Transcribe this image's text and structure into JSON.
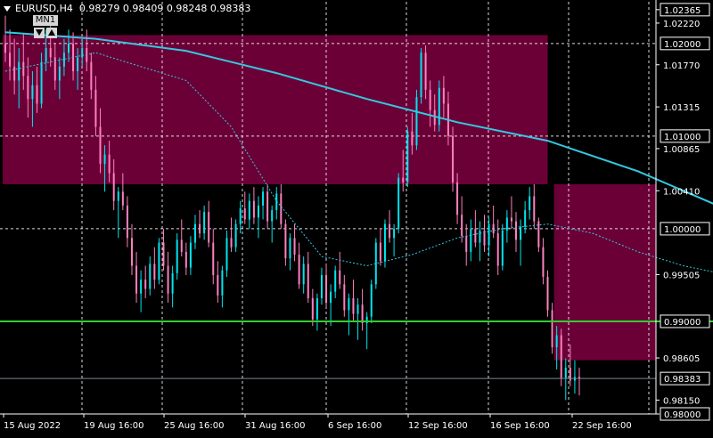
{
  "header": {
    "symbol": "EURUSD,H4",
    "open": "0.98279",
    "high": "0.98409",
    "low": "0.98248",
    "close": "0.98383",
    "timeframe_badge": "MN1"
  },
  "colors": {
    "background": "#000000",
    "grid": "#ffffff",
    "bull": "#00e5ee",
    "bear": "#ff7fbf",
    "zone": "#6b0037",
    "ma_solid": "#33c9e0",
    "ma_dashed": "#33c9e0",
    "level_line": "#32cd32",
    "price_line": "#778899",
    "axis_text": "#ffffff",
    "label_box": "#ffffff"
  },
  "chart_data": {
    "type": "candlestick",
    "title": "",
    "xlabel": "",
    "ylabel": "",
    "ylim": [
      0.98,
      1.0245
    ],
    "y_ticks": [
      "1.02365",
      "1.02220",
      "1.01770",
      "1.01315",
      "1.00865",
      "1.00410",
      "0.99505",
      "0.98605",
      "0.98150",
      "0.98000"
    ],
    "y_boxed_labels": [
      "1.02365",
      "1.02000",
      "1.01000",
      "1.00000",
      "0.99000",
      "0.98383",
      "0.98000"
    ],
    "x_ticks": [
      "15 Aug 2022",
      "19 Aug 16:00",
      "25 Aug 16:00",
      "31 Aug 16:00",
      "6 Sep 16:00",
      "12 Sep 16:00",
      "16 Sep 16:00",
      "22 Sep 16:00"
    ],
    "current_price": 0.98383,
    "grid": true,
    "zones": [
      {
        "start_bar": 0,
        "end_bar": 120,
        "high": 1.0209,
        "low": 1.0048
      },
      {
        "start_bar": 122,
        "end_bar": 320,
        "high": 1.0048,
        "low": 0.9858
      }
    ],
    "levels": [
      {
        "value": 1.02,
        "start_bar": 190,
        "end_bar": 280
      },
      {
        "value": 0.9945,
        "start_bar": 190,
        "end_bar": 280
      },
      {
        "value": 0.99,
        "start_bar": 0,
        "end_bar": 280
      }
    ],
    "moving_averages": [
      {
        "style": "solid",
        "points": [
          [
            0,
            1.0212
          ],
          [
            20,
            1.0205
          ],
          [
            40,
            1.0192
          ],
          [
            60,
            1.0168
          ],
          [
            80,
            1.014
          ],
          [
            100,
            1.0115
          ],
          [
            120,
            1.0095
          ],
          [
            140,
            1.0062
          ],
          [
            160,
            1.002
          ],
          [
            180,
            1.0003
          ],
          [
            200,
            0.9996
          ],
          [
            220,
            0.9994
          ],
          [
            240,
            0.9996
          ],
          [
            260,
            0.9998
          ],
          [
            270,
            0.9993
          ],
          [
            280,
            0.9987
          ]
        ]
      },
      {
        "style": "dashed",
        "points": [
          [
            0,
            1.017
          ],
          [
            20,
            1.019
          ],
          [
            40,
            1.016
          ],
          [
            50,
            1.011
          ],
          [
            60,
            1.003
          ],
          [
            70,
            0.997
          ],
          [
            80,
            0.996
          ],
          [
            90,
            0.9972
          ],
          [
            100,
            0.999
          ],
          [
            110,
            1.0
          ],
          [
            120,
            1.0005
          ],
          [
            130,
            0.9995
          ],
          [
            140,
            0.9975
          ],
          [
            150,
            0.996
          ],
          [
            165,
            0.9945
          ],
          [
            175,
            0.995
          ],
          [
            185,
            0.998
          ],
          [
            195,
            1.005
          ],
          [
            205,
            1.0078
          ],
          [
            215,
            1.0075
          ],
          [
            225,
            1.005
          ],
          [
            235,
            1.001
          ],
          [
            245,
            0.9995
          ],
          [
            255,
            0.9998
          ],
          [
            265,
            0.9975
          ],
          [
            275,
            0.994
          ],
          [
            280,
            0.9927
          ]
        ]
      }
    ],
    "candles": [
      [
        1.02,
        1.023,
        1.018,
        1.019
      ],
      [
        1.019,
        1.0215,
        1.016,
        1.0175
      ],
      [
        1.0175,
        1.0205,
        1.0145,
        1.016
      ],
      [
        1.016,
        1.0195,
        1.013,
        1.018
      ],
      [
        1.018,
        1.021,
        1.015,
        1.0165
      ],
      [
        1.0165,
        1.0185,
        1.012,
        1.014
      ],
      [
        1.014,
        1.017,
        1.011,
        1.0155
      ],
      [
        1.0155,
        1.0175,
        1.0125,
        1.0135
      ],
      [
        1.0135,
        1.019,
        1.013,
        1.018
      ],
      [
        1.018,
        1.0215,
        1.017,
        1.0195
      ],
      [
        1.0195,
        1.022,
        1.0175,
        1.0185
      ],
      [
        1.0185,
        1.02,
        1.015,
        1.016
      ],
      [
        1.016,
        1.0185,
        1.014,
        1.0175
      ],
      [
        1.0175,
        1.0205,
        1.0165,
        1.019
      ],
      [
        1.019,
        1.0215,
        1.018,
        1.02
      ],
      [
        1.02,
        1.0212,
        1.016,
        1.017
      ],
      [
        1.017,
        1.0195,
        1.015,
        1.0185
      ],
      [
        1.0185,
        1.0205,
        1.0175,
        1.0195
      ],
      [
        1.0195,
        1.0215,
        1.017,
        1.018
      ],
      [
        1.018,
        1.019,
        1.014,
        1.015
      ],
      [
        1.015,
        1.0165,
        1.01,
        1.011
      ],
      [
        1.011,
        1.013,
        1.006,
        1.007
      ],
      [
        1.007,
        1.009,
        1.004,
        1.008
      ],
      [
        1.008,
        1.0095,
        1.005,
        1.006
      ],
      [
        1.006,
        1.0075,
        1.002,
        1.003
      ],
      [
        1.003,
        1.0045,
        0.999,
        1.004
      ],
      [
        1.004,
        1.006,
        1.002,
        1.0025
      ],
      [
        1.0025,
        1.0035,
        0.998,
        0.999
      ],
      [
        0.999,
        1.0005,
        0.995,
        0.996
      ],
      [
        0.996,
        0.9975,
        0.992,
        0.993
      ],
      [
        0.993,
        0.9955,
        0.991,
        0.9945
      ],
      [
        0.9945,
        0.996,
        0.9925,
        0.9935
      ],
      [
        0.9935,
        0.997,
        0.9928,
        0.9962
      ],
      [
        0.9962,
        0.998,
        0.9935,
        0.9945
      ],
      [
        0.9945,
        0.999,
        0.994,
        0.9985
      ],
      [
        0.9985,
        1.0,
        0.9955,
        0.996
      ],
      [
        0.996,
        0.9975,
        0.992,
        0.993
      ],
      [
        0.993,
        0.996,
        0.9915,
        0.9952
      ],
      [
        0.9952,
        0.9995,
        0.9945,
        0.9988
      ],
      [
        0.9988,
        1.001,
        0.997,
        0.9975
      ],
      [
        0.9975,
        0.9985,
        0.995,
        0.9958
      ],
      [
        0.9958,
        0.9992,
        0.995,
        0.9985
      ],
      [
        0.9985,
        1.0015,
        0.9978,
        1.0005
      ],
      [
        1.0005,
        1.002,
        0.999,
        0.9995
      ],
      [
        0.9995,
        1.0025,
        0.9988,
        1.0018
      ],
      [
        1.0018,
        1.003,
        0.998,
        0.9985
      ],
      [
        0.9985,
        1.0,
        0.994,
        0.995
      ],
      [
        0.995,
        0.9965,
        0.992,
        0.9928
      ],
      [
        0.9928,
        0.996,
        0.9915,
        0.9955
      ],
      [
        0.9955,
        0.9998,
        0.9948,
        0.999
      ],
      [
        0.999,
        1.0012,
        0.9975,
        0.998
      ],
      [
        0.998,
        1.001,
        0.9975,
        1.0005
      ],
      [
        1.0005,
        1.003,
        0.9995,
        1.0022
      ],
      [
        1.0022,
        1.004,
        1.0005,
        1.001
      ],
      [
        1.001,
        1.0038,
        1.0,
        1.003
      ],
      [
        1.003,
        1.0045,
        1.0005,
        1.0012
      ],
      [
        1.0012,
        1.0035,
        0.999,
        1.0025
      ],
      [
        1.0025,
        1.0045,
        1.001,
        1.004
      ],
      [
        1.004,
        1.0048,
        1.0,
        1.0008
      ],
      [
        1.0008,
        1.0025,
        0.9985,
        1.002
      ],
      [
        1.002,
        1.0045,
        1.001,
        1.0038
      ],
      [
        1.0038,
        1.0048,
        1.0,
        1.0005
      ],
      [
        1.0005,
        1.001,
        0.996,
        0.9968
      ],
      [
        0.9968,
        0.9995,
        0.9955,
        0.999
      ],
      [
        0.999,
        1.0005,
        0.9965,
        0.9972
      ],
      [
        0.9972,
        0.9985,
        0.9935,
        0.994
      ],
      [
        0.994,
        0.997,
        0.993,
        0.9962
      ],
      [
        0.9962,
        0.9975,
        0.992,
        0.9925
      ],
      [
        0.9925,
        0.9935,
        0.9895,
        0.9902
      ],
      [
        0.9902,
        0.993,
        0.989,
        0.9925
      ],
      [
        0.9925,
        0.9958,
        0.9918,
        0.995
      ],
      [
        0.995,
        0.9962,
        0.9915,
        0.992
      ],
      [
        0.992,
        0.994,
        0.9895,
        0.9932
      ],
      [
        0.9932,
        0.996,
        0.9925,
        0.9955
      ],
      [
        0.9955,
        0.9975,
        0.9935,
        0.994
      ],
      [
        0.994,
        0.995,
        0.9905,
        0.9912
      ],
      [
        0.9912,
        0.993,
        0.9885,
        0.9925
      ],
      [
        0.9925,
        0.9945,
        0.99,
        0.9908
      ],
      [
        0.9908,
        0.9925,
        0.988,
        0.9918
      ],
      [
        0.9918,
        0.9935,
        0.989,
        0.9898
      ],
      [
        0.9898,
        0.991,
        0.987,
        0.9905
      ],
      [
        0.9905,
        0.9945,
        0.9898,
        0.994
      ],
      [
        0.994,
        0.999,
        0.9935,
        0.9985
      ],
      [
        0.9985,
        1.0,
        0.996,
        0.9965
      ],
      [
        0.9965,
        1.001,
        0.9958,
        1.0005
      ],
      [
        1.0005,
        1.002,
        0.9985,
        0.999
      ],
      [
        0.999,
        1.0005,
        0.997,
        1.0
      ],
      [
        1.0,
        1.006,
        0.9995,
        1.0055
      ],
      [
        1.0055,
        1.0085,
        1.004,
        1.005
      ],
      [
        1.005,
        1.011,
        1.0045,
        1.0105
      ],
      [
        1.0105,
        1.0125,
        1.008,
        1.009
      ],
      [
        1.009,
        1.015,
        1.0085,
        1.0142
      ],
      [
        1.0142,
        1.0195,
        1.0135,
        1.019
      ],
      [
        1.019,
        1.0198,
        1.014,
        1.015
      ],
      [
        1.015,
        1.016,
        1.011,
        1.0128
      ],
      [
        1.0128,
        1.0145,
        1.0105,
        1.0112
      ],
      [
        1.0112,
        1.016,
        1.0105,
        1.0152
      ],
      [
        1.0152,
        1.0165,
        1.012,
        1.0135
      ],
      [
        1.0135,
        1.0148,
        1.009,
        1.01
      ],
      [
        1.01,
        1.011,
        1.004,
        1.005
      ],
      [
        1.005,
        1.006,
        1.0005,
        1.0015
      ],
      [
        1.0015,
        1.0035,
        0.9985,
        0.9992
      ],
      [
        0.9992,
        1.0005,
        0.996,
        0.9975
      ],
      [
        0.9975,
        1.001,
        0.9965,
        1.0
      ],
      [
        1.0,
        1.002,
        0.998,
        0.9985
      ],
      [
        0.9985,
        1.0008,
        0.9965,
        0.9998
      ],
      [
        0.9998,
        1.0015,
        0.9975,
        0.9982
      ],
      [
        0.9982,
        1.0012,
        0.997,
        1.0005
      ],
      [
        1.0005,
        1.0025,
        0.999,
        0.9995
      ],
      [
        0.9995,
        1.001,
        0.995,
        0.996
      ],
      [
        0.996,
        1.0005,
        0.9955,
        0.9998
      ],
      [
        0.9998,
        1.002,
        0.9985,
        1.0012
      ],
      [
        1.0012,
        1.0035,
        1.0,
        1.0008
      ],
      [
        1.0008,
        1.0018,
        0.9975,
        0.9988
      ],
      [
        0.9988,
        1.001,
        0.996,
        1.0002
      ],
      [
        1.0002,
        1.003,
        0.9995,
        1.002
      ],
      [
        1.002,
        1.0045,
        1.001,
        1.0035
      ],
      [
        1.0035,
        1.0048,
        1.0,
        1.0008
      ],
      [
        1.0008,
        1.0012,
        0.9975,
        0.998
      ],
      [
        0.998,
        0.999,
        0.994,
        0.9948
      ],
      [
        0.9948,
        0.9955,
        0.9905,
        0.9912
      ],
      [
        0.9912,
        0.992,
        0.9865,
        0.9872
      ],
      [
        0.9872,
        0.9895,
        0.9848,
        0.9885
      ],
      [
        0.9885,
        0.9892,
        0.983,
        0.9838
      ],
      [
        0.9838,
        0.986,
        0.9815,
        0.985
      ],
      [
        0.985,
        0.9875,
        0.983,
        0.9836
      ],
      [
        0.9836,
        0.9858,
        0.9822,
        0.984
      ],
      [
        0.984,
        0.985,
        0.982,
        0.9838
      ]
    ]
  }
}
